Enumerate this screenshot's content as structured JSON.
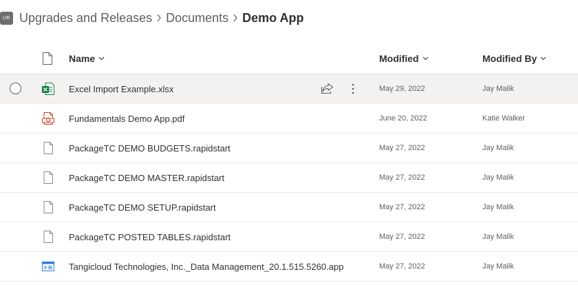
{
  "breadcrumb": {
    "site_badge": "UR",
    "items": [
      "Upgrades and Releases",
      "Documents",
      "Demo App"
    ]
  },
  "columns": {
    "name": "Name",
    "modified": "Modified",
    "modified_by": "Modified By"
  },
  "files": [
    {
      "name": "Excel Import Example.xlsx",
      "modified": "May 29, 2022",
      "modified_by": "Jay Malik",
      "icon": "excel-file-icon",
      "selected_hover": true
    },
    {
      "name": "Fundamentals Demo App.pdf",
      "modified": "June 20, 2022",
      "modified_by": "Katie Walker",
      "icon": "pdf-file-icon"
    },
    {
      "name": "PackageTC DEMO BUDGETS.rapidstart",
      "modified": "May 27, 2022",
      "modified_by": "Jay Malik",
      "icon": "generic-file-icon"
    },
    {
      "name": "PackageTC DEMO MASTER.rapidstart",
      "modified": "May 27, 2022",
      "modified_by": "Jay Malik",
      "icon": "generic-file-icon"
    },
    {
      "name": "PackageTC DEMO SETUP.rapidstart",
      "modified": "May 27, 2022",
      "modified_by": "Jay Malik",
      "icon": "generic-file-icon"
    },
    {
      "name": "PackageTC POSTED TABLES.rapidstart",
      "modified": "May 27, 2022",
      "modified_by": "Jay Malik",
      "icon": "generic-file-icon"
    },
    {
      "name": "Tangicloud Technologies, Inc._Data Management_20.1.515.5260.app",
      "modified": "May 27, 2022",
      "modified_by": "Jay Malik",
      "icon": "app-file-icon"
    }
  ],
  "colors": {
    "excel_green": "#107c41",
    "pdf_red": "#c43e1c",
    "app_blue": "#2b7cd3",
    "row_hover": "#f3f2f1"
  }
}
